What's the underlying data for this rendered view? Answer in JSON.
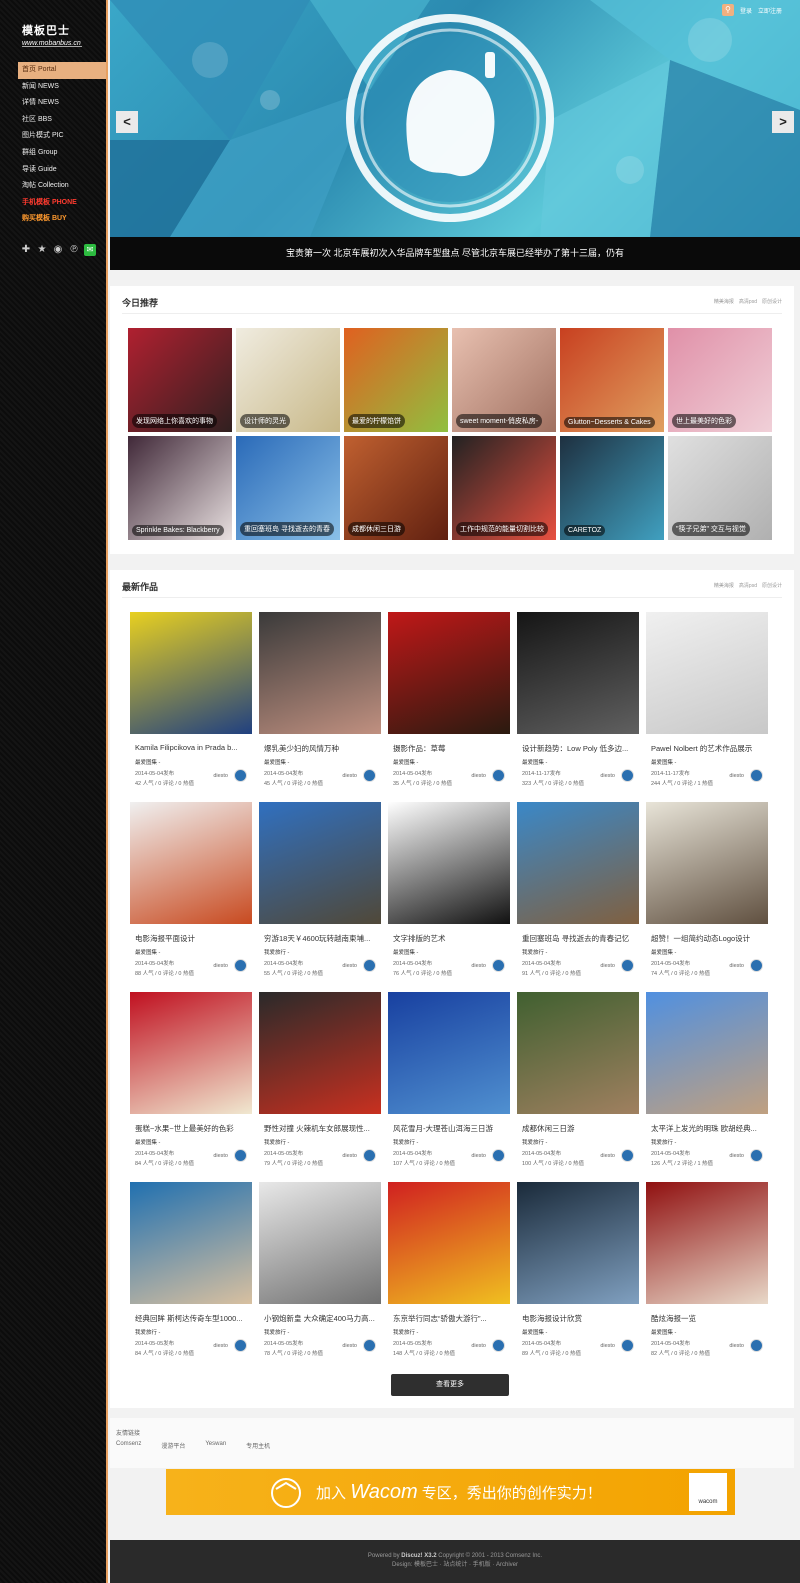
{
  "sidebar": {
    "logo_text": "模板巴士",
    "logo_url": "www.mobanbus.cn",
    "nav": [
      {
        "label": "首页 Portal",
        "style": "active"
      },
      {
        "label": "新闻 NEWS",
        "style": ""
      },
      {
        "label": "详情 NEWS",
        "style": ""
      },
      {
        "label": "社区 BBS",
        "style": ""
      },
      {
        "label": "图片模式 PIC",
        "style": ""
      },
      {
        "label": "群组 Group",
        "style": ""
      },
      {
        "label": "导读 Guide",
        "style": ""
      },
      {
        "label": "淘帖 Collection",
        "style": ""
      },
      {
        "label": "手机模板 PHONE",
        "style": "red"
      },
      {
        "label": "购买模板 BUY",
        "style": "orange"
      }
    ]
  },
  "top": {
    "login": "登录",
    "register": "立即注册"
  },
  "banner": {
    "caption": "宝贵第一次 北京车展初次入华品牌车型盘点 尽管北京车展已经举办了第十三届，仍有",
    "prev": "<",
    "next": ">"
  },
  "today": {
    "title": "今日推荐",
    "tabs": [
      "精美海报",
      "高清psd",
      "原创设计"
    ],
    "tiles": [
      {
        "label": "发现网络上你喜欢的事物",
        "c1": "#b02030",
        "c2": "#302020"
      },
      {
        "label": "设计师的灵光",
        "c1": "#f0ece0",
        "c2": "#c8b888"
      },
      {
        "label": "最爱的柠檬馅饼",
        "c1": "#e06020",
        "c2": "#90c040"
      },
      {
        "label": "sweet moment-俏皮私房-",
        "c1": "#e8c0b0",
        "c2": "#a07060"
      },
      {
        "label": "Glutton~Desserts & Cakes",
        "c1": "#c84020",
        "c2": "#e0a060"
      },
      {
        "label": "世上最美好的色彩",
        "c1": "#e090a8",
        "c2": "#f0d0d8"
      },
      {
        "label": "Sprinkle Bakes: Blackberry",
        "c1": "#402838",
        "c2": "#e8e0e0"
      },
      {
        "label": "重回塞班岛 寻找逝去的青春",
        "c1": "#2a6ab8",
        "c2": "#8ac0e8"
      },
      {
        "label": "成都休闲三日游",
        "c1": "#c06030",
        "c2": "#602010"
      },
      {
        "label": "工作中规范的能量切割比较",
        "c1": "#222222",
        "c2": "#e85040"
      },
      {
        "label": "CARETOZ",
        "c1": "#1e3040",
        "c2": "#40a0c0"
      },
      {
        "label": "\"筷子兄弟\" 交互与视觉",
        "c1": "#e0e0e0",
        "c2": "#b0b0b0"
      }
    ]
  },
  "latest": {
    "title": "最新作品",
    "tabs": [
      "精美海报",
      "高清psd",
      "原创设计"
    ],
    "more_button": "查看更多",
    "cards": [
      {
        "title": "Kamila Filipcikova in Prada b...",
        "cat": "最爱图集 -",
        "date": "2014-05-04发布",
        "stats": "42 人气 / 0 评论 / 0 热值",
        "author": "diesto",
        "c1": "#e8d020",
        "c2": "#204080"
      },
      {
        "title": "爆乳美少妇的风情万种",
        "cat": "最爱图集 -",
        "date": "2014-05-04发布",
        "stats": "45 人气 / 0 评论 / 0 热值",
        "author": "diesto",
        "c1": "#3a3a3a",
        "c2": "#c09080"
      },
      {
        "title": "摄影作品：草莓",
        "cat": "最爱图集 -",
        "date": "2014-05-04发布",
        "stats": "35 人气 / 0 评论 / 0 热值",
        "author": "diesto",
        "c1": "#c01818",
        "c2": "#2a1a10"
      },
      {
        "title": "设计新趋势：Low Poly 低多边...",
        "cat": "最爱图集 -",
        "date": "2014-11-17发布",
        "stats": "323 人气 / 0 评论 / 0 热值",
        "author": "diesto",
        "c1": "#151515",
        "c2": "#606060"
      },
      {
        "title": "Pawel Nolbert 的艺术作品展示",
        "cat": "最爱图集 -",
        "date": "2014-11-17发布",
        "stats": "244 人气 / 0 评论 / 1 热值",
        "author": "diesto",
        "c1": "#f0f0f0",
        "c2": "#c8c8c8"
      },
      {
        "title": "电影海报平面设计",
        "cat": "最爱图集 -",
        "date": "2014-05-04发布",
        "stats": "88 人气 / 0 评论 / 0 热值",
        "author": "diesto",
        "c1": "#f0f0f0",
        "c2": "#c84a20"
      },
      {
        "title": "穷游18天￥4600玩转越南柬埔...",
        "cat": "我爱旅行 -",
        "date": "2014-05-04发布",
        "stats": "55 人气 / 0 评论 / 0 热值",
        "author": "diesto",
        "c1": "#3070c0",
        "c2": "#504838"
      },
      {
        "title": "文字排版的艺术",
        "cat": "最爱图集 -",
        "date": "2014-05-04发布",
        "stats": "76 人气 / 0 评论 / 0 热值",
        "author": "diesto",
        "c1": "#ffffff",
        "c2": "#111111"
      },
      {
        "title": "重回塞班岛 寻找逝去的青春记忆",
        "cat": "我爱旅行 -",
        "date": "2014-05-04发布",
        "stats": "91 人气 / 0 评论 / 0 热值",
        "author": "diesto",
        "c1": "#3a88c8",
        "c2": "#806040"
      },
      {
        "title": "超赞！一组简约动态Logo设计",
        "cat": "最爱图集 -",
        "date": "2014-05-04发布",
        "stats": "74 人气 / 0 评论 / 0 热值",
        "author": "diesto",
        "c1": "#e8e4d8",
        "c2": "#605040"
      },
      {
        "title": "蛋糕~水果~世上最美好的色彩",
        "cat": "最爱图集 -",
        "date": "2014-05-04发布",
        "stats": "84 人气 / 0 评论 / 0 热值",
        "author": "diesto",
        "c1": "#c01020",
        "c2": "#f0e8d0"
      },
      {
        "title": "野性对撞 火辣机车女郎展现性...",
        "cat": "我爱旅行 -",
        "date": "2014-05-05发布",
        "stats": "79 人气 / 0 评论 / 0 热值",
        "author": "diesto",
        "c1": "#2a2a2a",
        "c2": "#c83020"
      },
      {
        "title": "风花雪月-大理苍山洱海三日游",
        "cat": "我爱旅行 -",
        "date": "2014-05-04发布",
        "stats": "107 人气 / 0 评论 / 0 热值",
        "author": "diesto",
        "c1": "#1840a0",
        "c2": "#5090d0"
      },
      {
        "title": "成都休闲三日游",
        "cat": "我爱旅行 -",
        "date": "2014-05-04发布",
        "stats": "100 人气 / 0 评论 / 0 热值",
        "author": "diesto",
        "c1": "#406030",
        "c2": "#a08060"
      },
      {
        "title": "太平洋上发光的明珠 欧胡经典...",
        "cat": "我爱旅行 -",
        "date": "2014-05-04发布",
        "stats": "126 人气 / 2 评论 / 1 热值",
        "author": "diesto",
        "c1": "#5090e0",
        "c2": "#c0a080"
      },
      {
        "title": "经典回眸 斯柯达传奇车型1000...",
        "cat": "我爱旅行 -",
        "date": "2014-05-05发布",
        "stats": "84 人气 / 0 评论 / 0 热值",
        "author": "diesto",
        "c1": "#2070b0",
        "c2": "#d8c0a0"
      },
      {
        "title": "小钢炮新皇 大众确定400马力高...",
        "cat": "我爱旅行 -",
        "date": "2014-05-05发布",
        "stats": "78 人气 / 0 评论 / 0 热值",
        "author": "diesto",
        "c1": "#e8e8e8",
        "c2": "#707070"
      },
      {
        "title": "东京举行同志“骄傲大游行”...",
        "cat": "我爱旅行 -",
        "date": "2014-05-05发布",
        "stats": "148 人气 / 0 评论 / 0 热值",
        "author": "diesto",
        "c1": "#d02020",
        "c2": "#f0c020"
      },
      {
        "title": "电影海报设计欣赏",
        "cat": "最爱图集 -",
        "date": "2014-05-04发布",
        "stats": "89 人气 / 0 评论 / 0 热值",
        "author": "diesto",
        "c1": "#1a2a3a",
        "c2": "#80a0c0"
      },
      {
        "title": "酷炫海报一览",
        "cat": "最爱图集 -",
        "date": "2014-05-04发布",
        "stats": "82 人气 / 0 评论 / 0 热值",
        "author": "diesto",
        "c1": "#901010",
        "c2": "#e8d8c8"
      }
    ]
  },
  "links": {
    "title": "友情链接",
    "items": [
      "Comsenz",
      "漫游平台",
      "Yeswan",
      "专用主机"
    ]
  },
  "ad": {
    "text_pre": "加入",
    "text_brand": "Wacom",
    "text_post": "专区，秀出你的创作实力！",
    "logo": "wacom"
  },
  "footer": {
    "line1_pre": "Powered by",
    "line1_brand": "Discuz! X3.2",
    "line1_post": "Copyright © 2001 - 2013 Comsenz Inc.",
    "line2": "Design: 模板巴士 · 站点统计 · 手机版 · Archiver"
  },
  "colors": {
    "accent": "#e8a060",
    "banner": "#2b8ab0",
    "sidebar_bg": "#111111"
  }
}
